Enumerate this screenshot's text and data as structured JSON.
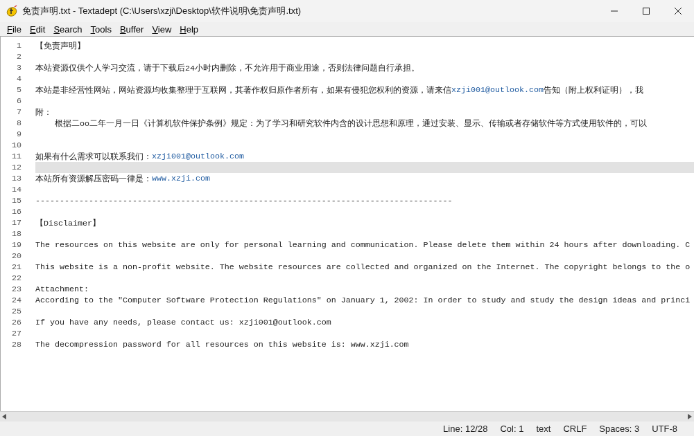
{
  "window": {
    "title": "免责声明.txt - Textadept (C:\\Users\\xzji\\Desktop\\软件说明\\免责声明.txt)"
  },
  "menu": [
    {
      "label": "File"
    },
    {
      "label": "Edit"
    },
    {
      "label": "Search"
    },
    {
      "label": "Tools"
    },
    {
      "label": "Buffer"
    },
    {
      "label": "View"
    },
    {
      "label": "Help"
    }
  ],
  "editor": {
    "lines": [
      {
        "number": "1",
        "selected": false,
        "parts": [
          {
            "kind": "text",
            "text": "【免责声明】"
          }
        ]
      },
      {
        "number": "2",
        "selected": false
      },
      {
        "number": "3",
        "selected": false,
        "parts": [
          {
            "kind": "text",
            "text": "本站资源仅供个人学习交流，请于下载后24小时内删除，不允许用于商业用途，否则法律问题自行承担。"
          }
        ]
      },
      {
        "number": "4",
        "selected": false
      },
      {
        "number": "5",
        "selected": false,
        "parts": [
          {
            "kind": "text",
            "text": "本站是非经营性网站，网站资源均收集整理于互联网，其著作权归原作者所有，如果有侵犯您权利的资源，请来信"
          },
          {
            "kind": "link",
            "text": "xzji001@outlook.com"
          },
          {
            "kind": "text",
            "text": "告知（附上权利证明），我"
          }
        ]
      },
      {
        "number": "6",
        "selected": false
      },
      {
        "number": "7",
        "selected": false,
        "parts": [
          {
            "kind": "text",
            "text": "附："
          }
        ]
      },
      {
        "number": "8",
        "selected": false,
        "parts": [
          {
            "kind": "text",
            "text": "    根据二oo二年一月一日《计算机软件保护条例》规定：为了学习和研究软件内含的设计思想和原理，通过安装、显示、传输或者存储软件等方式使用软件的，可以"
          }
        ]
      },
      {
        "number": "9",
        "selected": false
      },
      {
        "number": "10",
        "selected": false
      },
      {
        "number": "11",
        "selected": false,
        "parts": [
          {
            "kind": "text",
            "text": "如果有什么需求可以联系我们："
          },
          {
            "kind": "link",
            "text": "xzji001@outlook.com"
          }
        ]
      },
      {
        "number": "12",
        "selected": true
      },
      {
        "number": "13",
        "selected": false,
        "parts": [
          {
            "kind": "text",
            "text": "本站所有资源解压密码一律是："
          },
          {
            "kind": "link",
            "text": "www.xzji.com"
          }
        ]
      },
      {
        "number": "14",
        "selected": false
      },
      {
        "number": "15",
        "selected": false,
        "parts": [
          {
            "kind": "text",
            "text": "--------------------------------------------------------------------------------------"
          }
        ]
      },
      {
        "number": "16",
        "selected": false
      },
      {
        "number": "17",
        "selected": false,
        "parts": [
          {
            "kind": "text",
            "text": "【Disclaimer】"
          }
        ]
      },
      {
        "number": "18",
        "selected": false
      },
      {
        "number": "19",
        "selected": false,
        "parts": [
          {
            "kind": "text",
            "text": "The resources on this website are only for personal learning and communication. Please delete them within 24 hours after downloading. C"
          }
        ]
      },
      {
        "number": "20",
        "selected": false
      },
      {
        "number": "21",
        "selected": false,
        "parts": [
          {
            "kind": "text",
            "text": "This website is a non-profit website. The website resources are collected and organized on the Internet. The copyright belongs to the o"
          }
        ]
      },
      {
        "number": "22",
        "selected": false
      },
      {
        "number": "23",
        "selected": false,
        "parts": [
          {
            "kind": "text",
            "text": "Attachment:"
          }
        ]
      },
      {
        "number": "24",
        "selected": false,
        "parts": [
          {
            "kind": "text",
            "text": "According to the \"Computer Software Protection Regulations\" on January 1, 2002: In order to study and study the design ideas and princi"
          }
        ]
      },
      {
        "number": "25",
        "selected": false
      },
      {
        "number": "26",
        "selected": false,
        "parts": [
          {
            "kind": "text",
            "text": "If you have any needs, please contact us: xzji001@outlook.com"
          }
        ]
      },
      {
        "number": "27",
        "selected": false
      },
      {
        "number": "28",
        "selected": false,
        "parts": [
          {
            "kind": "text",
            "text": "The decompression password for all resources on this website is: www.xzji.com"
          }
        ]
      }
    ]
  },
  "status_bar": [
    "Line: 12/28",
    "Col: 1",
    "text",
    "CRLF",
    "Spaces: 3",
    "UTF-8"
  ]
}
